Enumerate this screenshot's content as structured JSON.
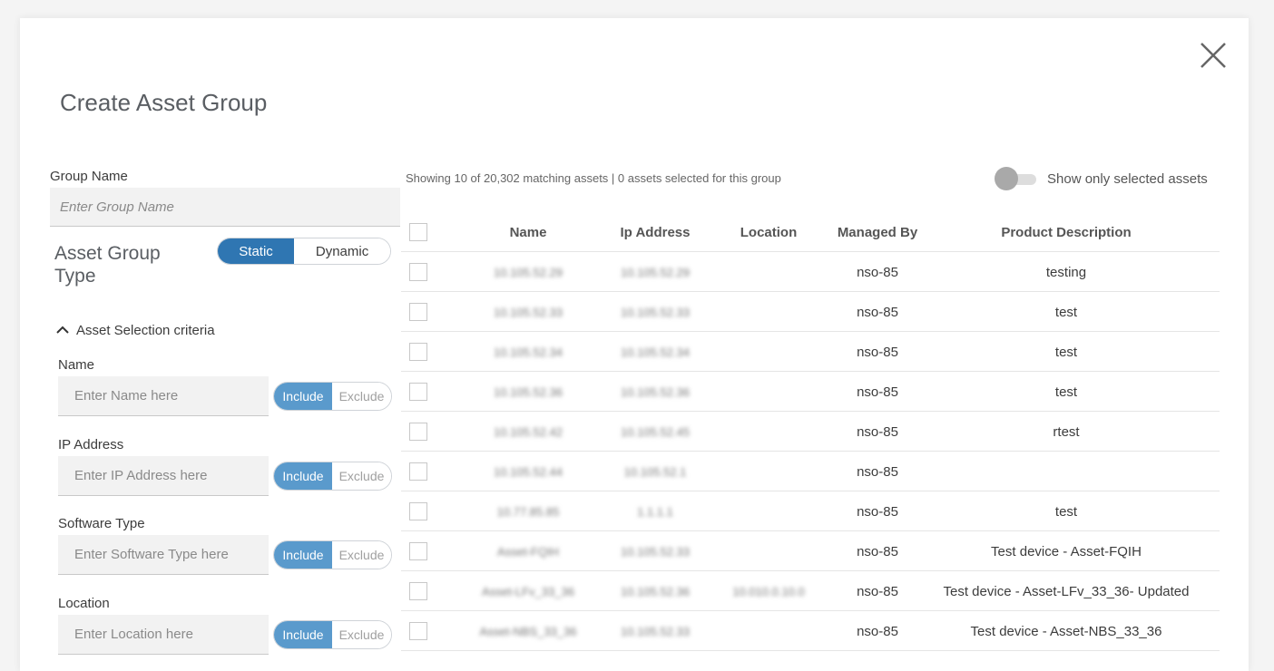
{
  "title": "Create Asset Group",
  "group_name": {
    "label": "Group Name",
    "placeholder": "Enter Group Name"
  },
  "group_type": {
    "label": "Asset Group Type",
    "options": [
      "Static",
      "Dynamic"
    ],
    "selected": "Static"
  },
  "criteria": {
    "label": "Asset Selection criteria",
    "include": "Include",
    "exclude": "Exclude",
    "fields": [
      {
        "label": "Name",
        "placeholder": "Enter Name here"
      },
      {
        "label": "IP Address",
        "placeholder": "Enter IP Address here"
      },
      {
        "label": "Software Type",
        "placeholder": "Enter Software Type here"
      },
      {
        "label": "Location",
        "placeholder": "Enter Location here"
      }
    ]
  },
  "summary": "Showing 10 of 20,302 matching assets | 0 assets selected for this group",
  "toggle_label": "Show only selected assets",
  "columns": [
    "Name",
    "Ip Address",
    "Location",
    "Managed By",
    "Product Description"
  ],
  "rows": [
    [
      "10.105.52.29",
      "10.105.52.29",
      "",
      "nso-85",
      "testing"
    ],
    [
      "10.105.52.33",
      "10.105.52.33",
      "",
      "nso-85",
      "test"
    ],
    [
      "10.105.52.34",
      "10.105.52.34",
      "",
      "nso-85",
      "test"
    ],
    [
      "10.105.52.36",
      "10.105.52.36",
      "",
      "nso-85",
      "test"
    ],
    [
      "10.105.52.42",
      "10.105.52.45",
      "",
      "nso-85",
      "rtest"
    ],
    [
      "10.105.52.44",
      "10.105.52.1",
      "",
      "nso-85",
      ""
    ],
    [
      "10.77.85.85",
      "1.1.1.1",
      "",
      "nso-85",
      "test"
    ],
    [
      "Asset-FQIH",
      "10.105.52.33",
      "",
      "nso-85",
      "Test device - Asset-FQIH"
    ],
    [
      "Asset-LFv_33_36",
      "10.105.52.36",
      "10.010.0.10.0",
      "nso-85",
      "Test device - Asset-LFv_33_36- Updated"
    ],
    [
      "Asset-NBS_33_36",
      "10.105.52.33",
      "",
      "nso-85",
      "Test device - Asset-NBS_33_36"
    ]
  ]
}
